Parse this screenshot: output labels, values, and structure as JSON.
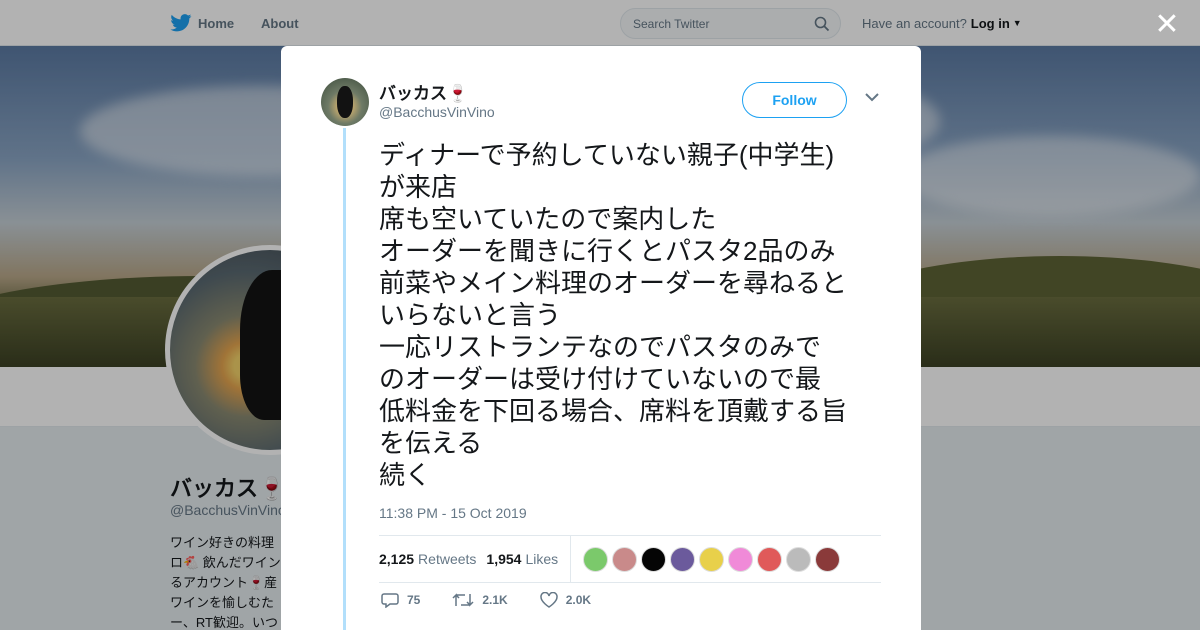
{
  "nav": {
    "home_label": "Home",
    "about_label": "About"
  },
  "search": {
    "placeholder": "Search Twitter"
  },
  "account": {
    "prompt": "Have an account?",
    "login_label": "Log in"
  },
  "profile": {
    "name": "バッカス🍷",
    "handle": "@BacchusVinVino",
    "bio_lines": [
      "ワイン好きの料理",
      "ロ🐔 飲んだワイン",
      "るアカウント🍷産",
      "ワインを愉しむた",
      "ー、RT歓迎。いつ"
    ]
  },
  "tweet": {
    "display_name": "バッカス🍷",
    "username": "@BacchusVinVino",
    "follow_label": "Follow",
    "text_lines": [
      "ディナーで予約していない親子(中学生)",
      "が来店",
      "席も空いていたので案内した",
      "オーダーを聞きに行くとパスタ2品のみ",
      "前菜やメイン料理のオーダーを尋ねると",
      "いらないと言う",
      "一応リストランテなのでパスタのみで",
      "のオーダーは受け付けていないので最",
      "低料金を下回る場合、席料を頂戴する旨",
      "を伝える",
      "続く"
    ],
    "timestamp": "11:38 PM - 15 Oct 2019",
    "retweets_count": "2,125",
    "retweets_label": "Retweets",
    "likes_count": "1,954",
    "likes_label": "Likes",
    "reply_count": "75",
    "retweet_action_count": "2.1K",
    "like_action_count": "2.0K"
  },
  "liker_colors": [
    "#7bc96b",
    "#c98a8a",
    "#050505",
    "#6b5a9c",
    "#e8d04a",
    "#f08ad8",
    "#e05a5a",
    "#bbbbbb",
    "#8a3a3a"
  ],
  "colors": {
    "accent": "#1da1f2",
    "thread_line": "#b2dffb",
    "text": "#14171a",
    "muted": "#657786"
  },
  "icons": {
    "close": "close-icon",
    "logo": "twitter-bird-icon",
    "search": "search-icon"
  }
}
